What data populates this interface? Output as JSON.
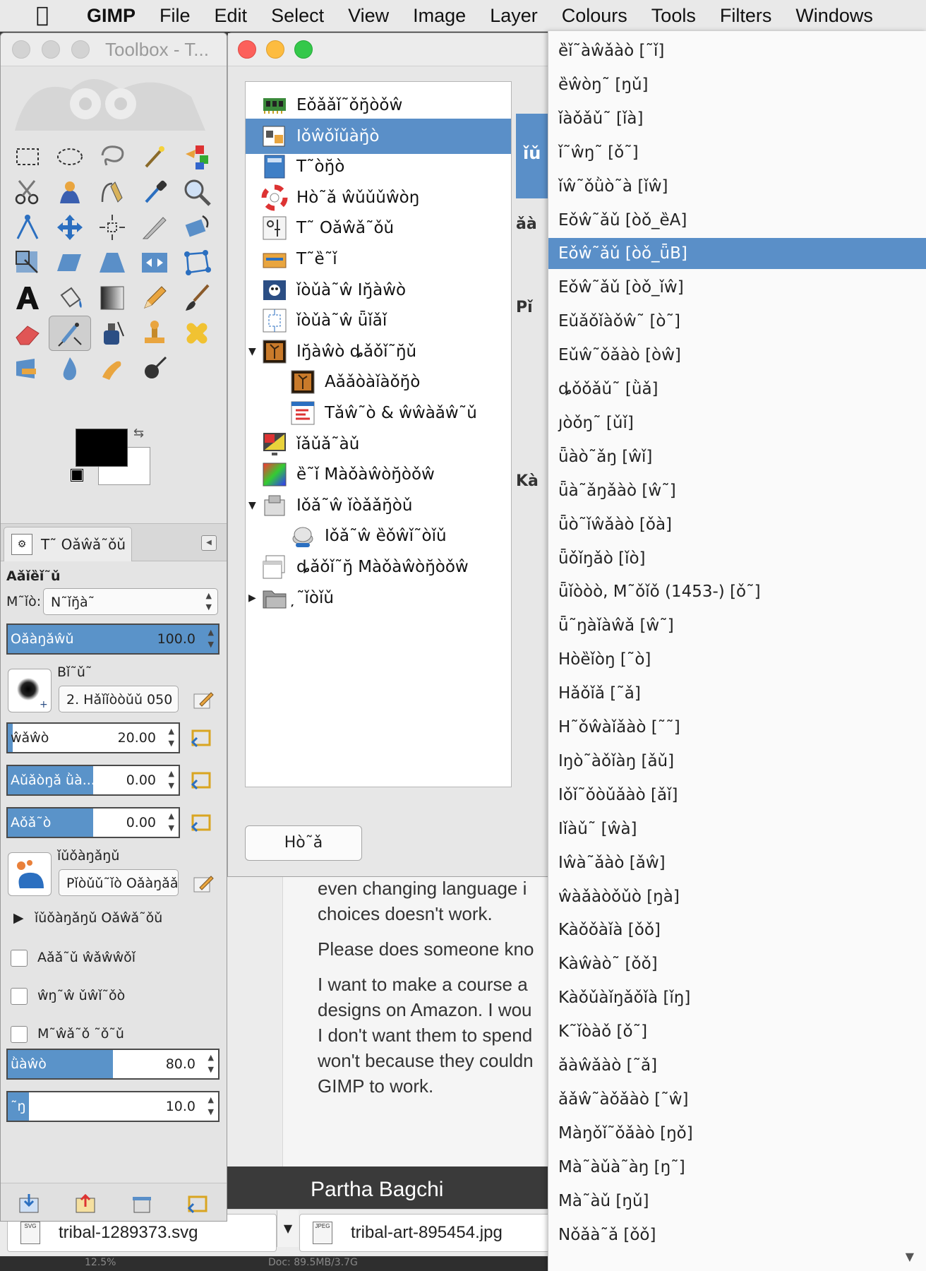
{
  "menubar": {
    "app": "GIMP",
    "items": [
      "File",
      "Edit",
      "Select",
      "View",
      "Image",
      "Layer",
      "Colours",
      "Tools",
      "Filters",
      "Windows"
    ]
  },
  "toolbox": {
    "title": "Toolbox - T...",
    "tab_label": "T˜ Oǎŵǎ˜ǒǔ",
    "section": "Aǎǐȅǐ˜ǔ",
    "mode_label": "M˜ǐò:",
    "mode_value": "N˜ǐŋ̆à˜",
    "opacity": {
      "name": "Oǎàŋǎŵǔ",
      "value": "100.0",
      "fraction": 1.0
    },
    "brush_label": "Bǐ˜ǔ˜",
    "brush_value": "2. Hǎǐǐòòǔǔ 050",
    "size": {
      "name": "ŵǎŵò",
      "value": "20.00",
      "fraction": 0.03
    },
    "aspect": {
      "name": "Aǔǎòŋǎ ǜà...",
      "value": "0.00",
      "fraction": 0.5
    },
    "angle": {
      "name": "Aǒǎ˜ò",
      "value": "0.00",
      "fraction": 0.5
    },
    "dynamics_label": "ǐǔǒàŋǎŋǔ",
    "dynamics_value": "Pǐòǔǔ˜ǐò Oǎàŋǎǎ",
    "dynamics_options": "ǐǔǒàŋǎŋǔ Oǎŵǎ˜ǒǔ",
    "apply_jitter": "Aǎǎ˜ǔ ŵǎŵŵǒǐ",
    "smooth_stroke": "ŵŋ˜ŵ ǔŵǐ˜ǒò",
    "lock_brush": "M˜ŵǎ˜ǒ ˜ǒ˜ǔ",
    "hardness": {
      "name": "ǜàŵò",
      "value": "80.0",
      "fraction": 0.5
    },
    "force": {
      "name": "˜ŋ",
      "value": "10.0",
      "fraction": 0.1
    }
  },
  "prefs": {
    "categories": [
      {
        "label": "Eǒǎǎǐ˜ǒŋ̆òǒŵ",
        "icon": "memory-chip-icon",
        "indent": 0,
        "expander": ""
      },
      {
        "label": "Iǒŵǒǐǔàŋ̆ò",
        "icon": "interface-icon",
        "indent": 0,
        "expander": "",
        "selected": true
      },
      {
        "label": "T˜òŋ̆ò",
        "icon": "theme-icon",
        "indent": 0,
        "expander": ""
      },
      {
        "label": "Hò˜ǎ ŵǔǔǔŵòŋ",
        "icon": "lifebuoy-icon",
        "indent": 0,
        "expander": ""
      },
      {
        "label": "T˜ Oǎŵǎ˜ǒǔ",
        "icon": "tool-options-icon",
        "indent": 0,
        "expander": ""
      },
      {
        "label": "T˜ȅ˜ǐ",
        "icon": "toolbox-icon",
        "indent": 0,
        "expander": ""
      },
      {
        "label": "ǐòǔà˜ŵ Iŋ̆àŵò",
        "icon": "default-image-icon",
        "indent": 0,
        "expander": ""
      },
      {
        "label": "ǐòǔà˜ŵ ǖǐǎǐ",
        "icon": "default-grid-icon",
        "indent": 0,
        "expander": ""
      },
      {
        "label": "Iŋ̆àŵò ȡǎǒǐ˜ŋ̆ǔ",
        "icon": "image-windows-icon",
        "indent": 0,
        "expander": "▼"
      },
      {
        "label": "Aǎǎòàǐàǒŋ̆ò",
        "icon": "appearance-icon",
        "indent": 1,
        "expander": ""
      },
      {
        "label": "Tǎŵ˜ò & ŵŵàǎŵ˜ǔ",
        "icon": "title-status-icon",
        "indent": 1,
        "expander": ""
      },
      {
        "label": "ǐǎǔǎ˜àǔ",
        "icon": "display-icon",
        "indent": 0,
        "expander": ""
      },
      {
        "label": "ȅ˜ǐ Màǒàŵòŋ̆òǒŵ",
        "icon": "colour-management-icon",
        "indent": 0,
        "expander": ""
      },
      {
        "label": "Iǒǎ˜ŵ ǐòǎǎŋ̆òǔ",
        "icon": "input-devices-icon",
        "indent": 0,
        "expander": "▼"
      },
      {
        "label": "Iǒǎ˜ŵ ȅǒŵǐ˜òǐǔ",
        "icon": "input-controllers-icon",
        "indent": 1,
        "expander": ""
      },
      {
        "label": "ȡǎǒǐ˜ŋ̆ Màǒàŵòŋ̆òǒŵ",
        "icon": "window-management-icon",
        "indent": 0,
        "expander": ""
      },
      {
        "label": "̦˜ǐòǐǔ",
        "icon": "folders-icon",
        "indent": 0,
        "expander": "▶"
      }
    ],
    "help_button": "Hò˜ǎ",
    "right_panel": {
      "header": "ǐǔ",
      "t1": "ǎà",
      "t2": "Pǐ",
      "t3": "Kà"
    }
  },
  "webpage": {
    "p1a": "even changing language i",
    "p1b": "choices doesn't work.",
    "p2": "Please does someone kno",
    "p3a": "I want to make a course a",
    "p3b": "designs on Amazon. I wou",
    "p3c": "I don't want them to spend",
    "p3d": "won't because they couldn",
    "p3e": "GIMP to work.",
    "author": "Partha Bagchi"
  },
  "image_tabs": [
    {
      "name": "tribal-1289373.svg",
      "type": "SVG"
    },
    {
      "name": "tribal-art-895454.jpg",
      "type": "JPEG"
    }
  ],
  "status": {
    "left": "12.5%",
    "right": "Doc: 89.5MB/3.7G"
  },
  "languages": [
    "ȅǐ˜àŵǎàò [˜ǐ]",
    "ȅŵòŋ˜ [ŋǔ]",
    "ǐàǒǎǔ˜ [ǐà]",
    "ǐ˜ŵŋ˜ [ǒ˜]",
    "ǐŵ˜ǒǜò˜à [ǐŵ]",
    "Eǒŵ˜ǎǔ [òǒ_ȅA]",
    "Eǒŵ˜ǎǔ [òǒ_ǖB]",
    "Eǒŵ˜ǎǔ [òǒ_ǐŵ]",
    "Eǔǎǒǐàǒŵ˜ [ò˜]",
    "Eǔŵ˜ǒǎàò [òŵ]",
    "ȡǒǒǎǔ˜ [ǜǎ]",
    "ȷòǒŋ˜ [ǔǐ]",
    "ǖàò˜ǎŋ [ŵǐ]",
    "ǖà˜ǎŋǎàò [ŵ˜]",
    "ǖò˜ǐŵǎàò [ǒà]",
    "ǖǒǐŋǎò [ǐò]",
    "ǖǐòòò, M˜ǒǐǒ (1453-) [ǒ˜]",
    "ǖ˜ŋàǐàŵǎ [ŵ˜]",
    "Hòȅǐòŋ [˜ò]",
    "Hǎǒǐǎ [˜ǎ]",
    "H˜ǒŵàǐǎàò [˜˜]",
    "Iŋò˜àǒǐàŋ [ǎǔ]",
    "Iǒǐ˜ǒòǔǎàò [ǎǐ]",
    "Iǐàǔ˜ [ŵà]",
    "Iŵà˜ǎàò [ǎŵ]",
    "ŵàǎàòǒǔò [ŋà]",
    "Kàǒǒàǐà [ǒǒ]",
    "Kàŵàò˜ [ǒǒ]",
    "Kàǒǔàǐŋǎǒǐà [ǐŋ]",
    "K˜ǐòàǒ [ǒ˜]",
    "ǎàŵǎàò [˜ǎ]",
    "ǎǎŵ˜àǒǎàò [˜ŵ]",
    "Màŋǒǐ˜ǒǎàò [ŋǒ]",
    "Mà˜àǔà˜àŋ [ŋ˜]",
    "Mà˜àǔ [ŋǔ]",
    "Nǒǎà˜ǎ [ǒǒ]"
  ],
  "languages_selected": 6,
  "colors": {
    "accent": "#5a8fc8",
    "fg": "#000000",
    "bg": "#ffffff"
  }
}
